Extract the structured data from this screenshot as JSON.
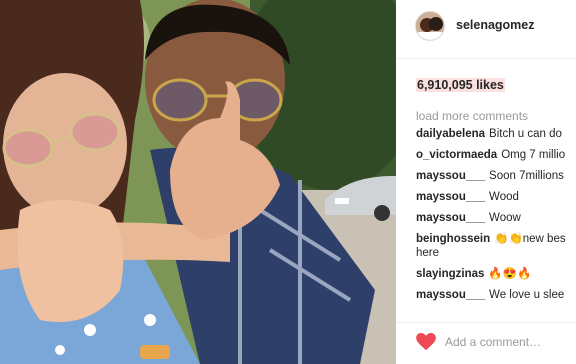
{
  "post": {
    "username": "selenagomez",
    "likes": "6,910,095 likes",
    "load_more": "load more comments",
    "comments": [
      {
        "user": "dailyabelena",
        "text": "Bitch u can do"
      },
      {
        "user": "o_victormaeda",
        "text": "Omg 7 millio"
      },
      {
        "user": "mayssou___",
        "text": "Soon 7millions"
      },
      {
        "user": "mayssou___",
        "text": "Wood"
      },
      {
        "user": "mayssou___",
        "text": "Woow"
      },
      {
        "user": "beinghossein",
        "text": "👏👏new bes here"
      },
      {
        "user": "slayingzinas",
        "text": "🔥😍🔥"
      },
      {
        "user": "mayssou___",
        "text": "We love u slee"
      }
    ],
    "add_comment_placeholder": "Add a comment…"
  },
  "colors": {
    "heart": "#ed4956",
    "likes_highlight": "#fbe0e0"
  },
  "icons": {
    "like": "heart-icon"
  }
}
